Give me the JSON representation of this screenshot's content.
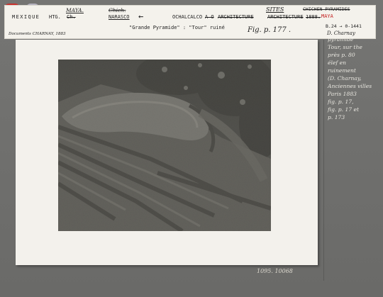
{
  "label": {
    "country": "MEXIQUE",
    "region_typed": "HTG.",
    "region_typed_2": "Ch.",
    "region_hand": "MAYA.",
    "site_hand": "Chich.",
    "site_typed": "NARASCO",
    "arrow": "←",
    "locality": "OCHALCALCO",
    "struck_mid": "A O",
    "struck_typed": "ARCHITECTURE",
    "struck_typed_2": "ARCHITECTURE",
    "struck_typed_3": "1888.",
    "category_hand": "SITES",
    "struck_right": "CHICHEN-PYRAMIDES",
    "culture_red": "MAYA",
    "caption": "\"Grande Pyramide\" : \"Tour\" ruiné",
    "figure_ref": "Fig. p. 177 .",
    "ref_code": "B.24 → 0-1441",
    "signature": "D. Charnay",
    "source": "Documents CHARNAY, 1883"
  },
  "margin_note": [
    "pyramide",
    "Tour, sur the",
    "près p. 80",
    "élef en",
    "ruinement",
    "(D. Charnay,",
    "Anciennes villes",
    "Paris 1883",
    "fig. p. 17,",
    "fig. p. 17 et",
    "p. 173"
  ],
  "shelf_mark": "1095. 10068",
  "colors": {
    "background": "#6f6f6d",
    "label_paper": "#f4f2ec",
    "mount": "#f3f1ec",
    "accent_red": "#c21d1d"
  }
}
